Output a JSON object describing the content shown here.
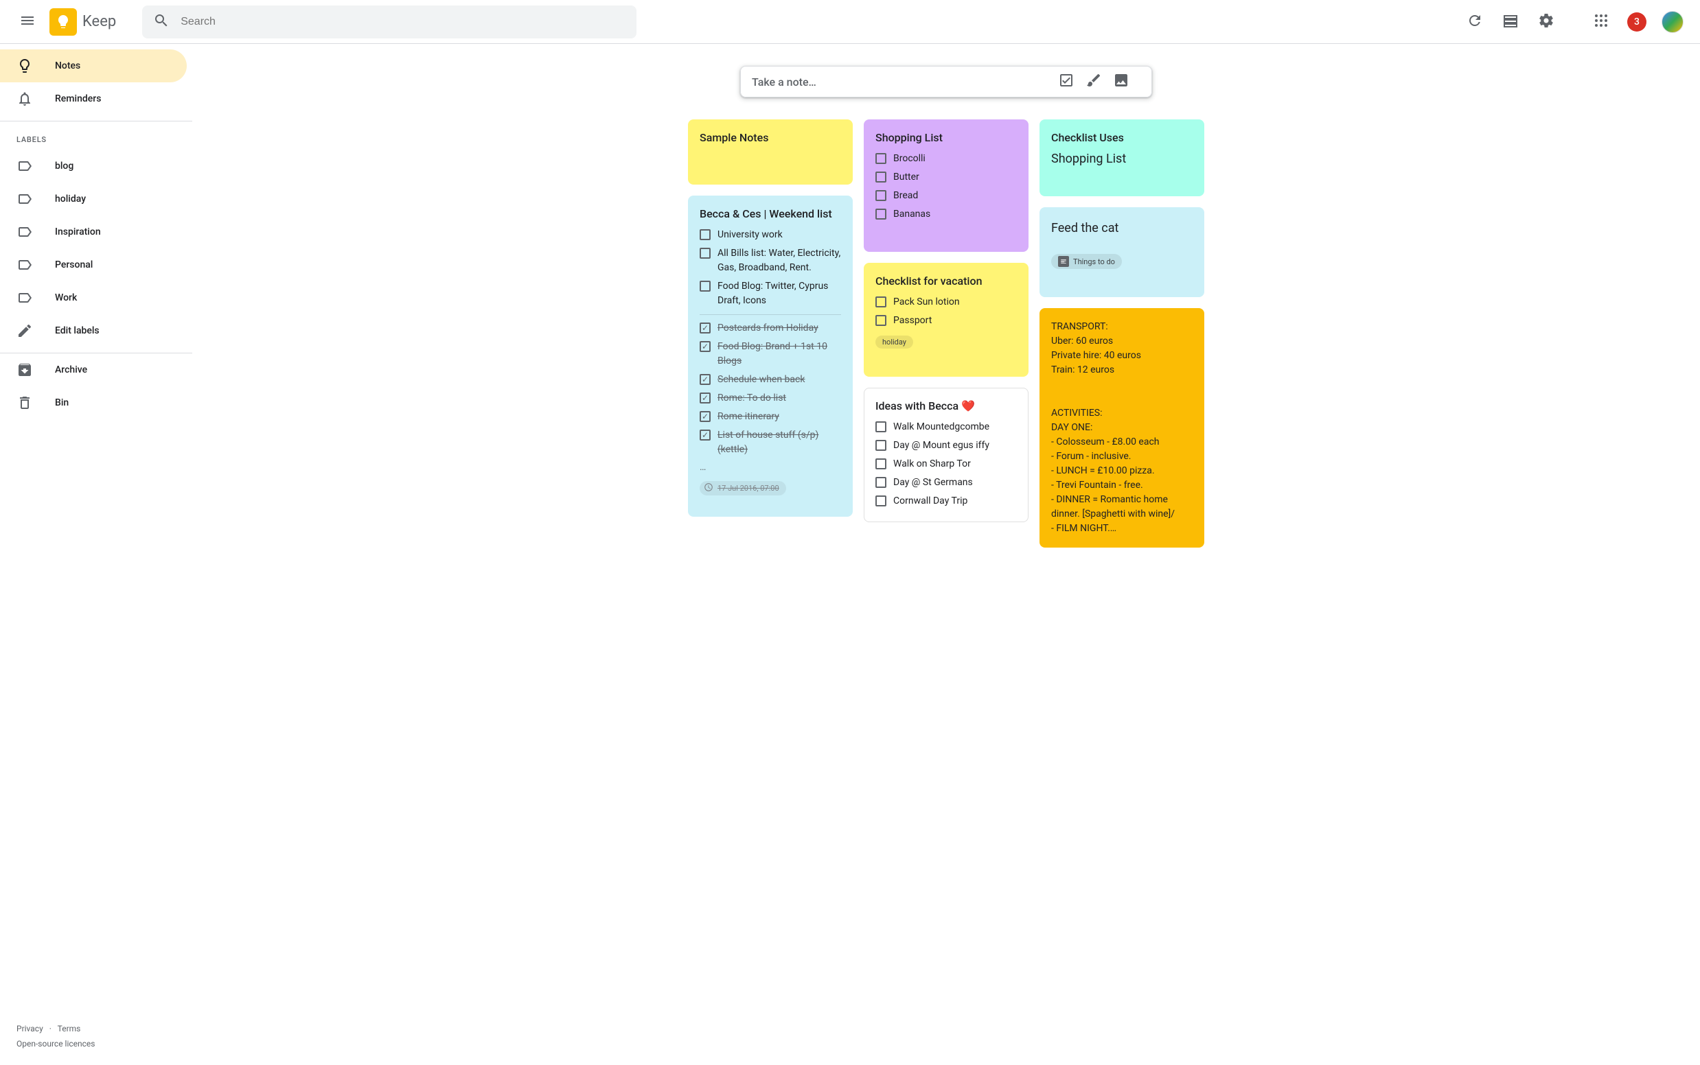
{
  "header": {
    "product": "Keep",
    "search_placeholder": "Search",
    "notification_count": "3"
  },
  "sidebar": {
    "notes": "Notes",
    "reminders": "Reminders",
    "labels_header": "LABELS",
    "labels": [
      "blog",
      "holiday",
      "Inspiration",
      "Personal",
      "Work"
    ],
    "edit_labels": "Edit labels",
    "archive": "Archive",
    "bin": "Bin"
  },
  "footer": {
    "privacy": "Privacy",
    "terms": "Terms",
    "licences": "Open-source licences"
  },
  "take_note": "Take a note…",
  "notes": {
    "sample": {
      "title": "Sample Notes",
      "color": "#fff475"
    },
    "weekend": {
      "title": "Becca & Ces | Weekend list",
      "color": "#cbf0f8",
      "unchecked": [
        "University work",
        "All Bills list: Water, Electricity, Gas, Broadband, Rent.",
        "Food Blog: Twitter, Cyprus Draft, Icons"
      ],
      "checked": [
        "Postcards from Holiday",
        "Food Blog: Brand + 1st 10 Blogs",
        "Schedule when back",
        "Rome: To do list",
        "Rome itinerary",
        "List of house stuff (s/p) (kettle)"
      ],
      "timestamp": "17 Jul 2016, 07:00"
    },
    "shopping": {
      "title": "Shopping List",
      "color": "#d7aefb",
      "items": [
        "Brocolli",
        "Butter",
        "Bread",
        "Bananas"
      ]
    },
    "vacation": {
      "title": "Checklist for vacation",
      "color": "#fff475",
      "items": [
        "Pack Sun lotion",
        "Passport"
      ],
      "label_chip": "holiday"
    },
    "ideas": {
      "title": "Ideas with Becca ❤️",
      "color": "#ffffff",
      "items": [
        "Walk Mountedgcombe",
        "Day @ Mount egus iffy",
        "Walk on Sharp Tor",
        "Day @ St Germans",
        "Cornwall Day Trip"
      ]
    },
    "checklist_uses": {
      "title": "Checklist Uses",
      "body": "Shopping List",
      "color": "#a7ffeb"
    },
    "feed_cat": {
      "title": "Feed the cat",
      "color": "#cbf0f8",
      "doc_chip": "Things to do"
    },
    "transport": {
      "color": "#fbbc04",
      "lines": [
        "TRANSPORT:",
        "Uber: 60 euros",
        "Private hire: 40 euros",
        "Train: 12 euros",
        "",
        "",
        "ACTIVITIES:",
        "DAY ONE:",
        "- Colosseum - £8.00 each",
        "- Forum - inclusive.",
        "- LUNCH = £10.00 pizza.",
        "- Trevi Fountain - free.",
        "- DINNER = Romantic home dinner. [Spaghetti with wine]/",
        "- FILM NIGHT.…"
      ]
    }
  }
}
